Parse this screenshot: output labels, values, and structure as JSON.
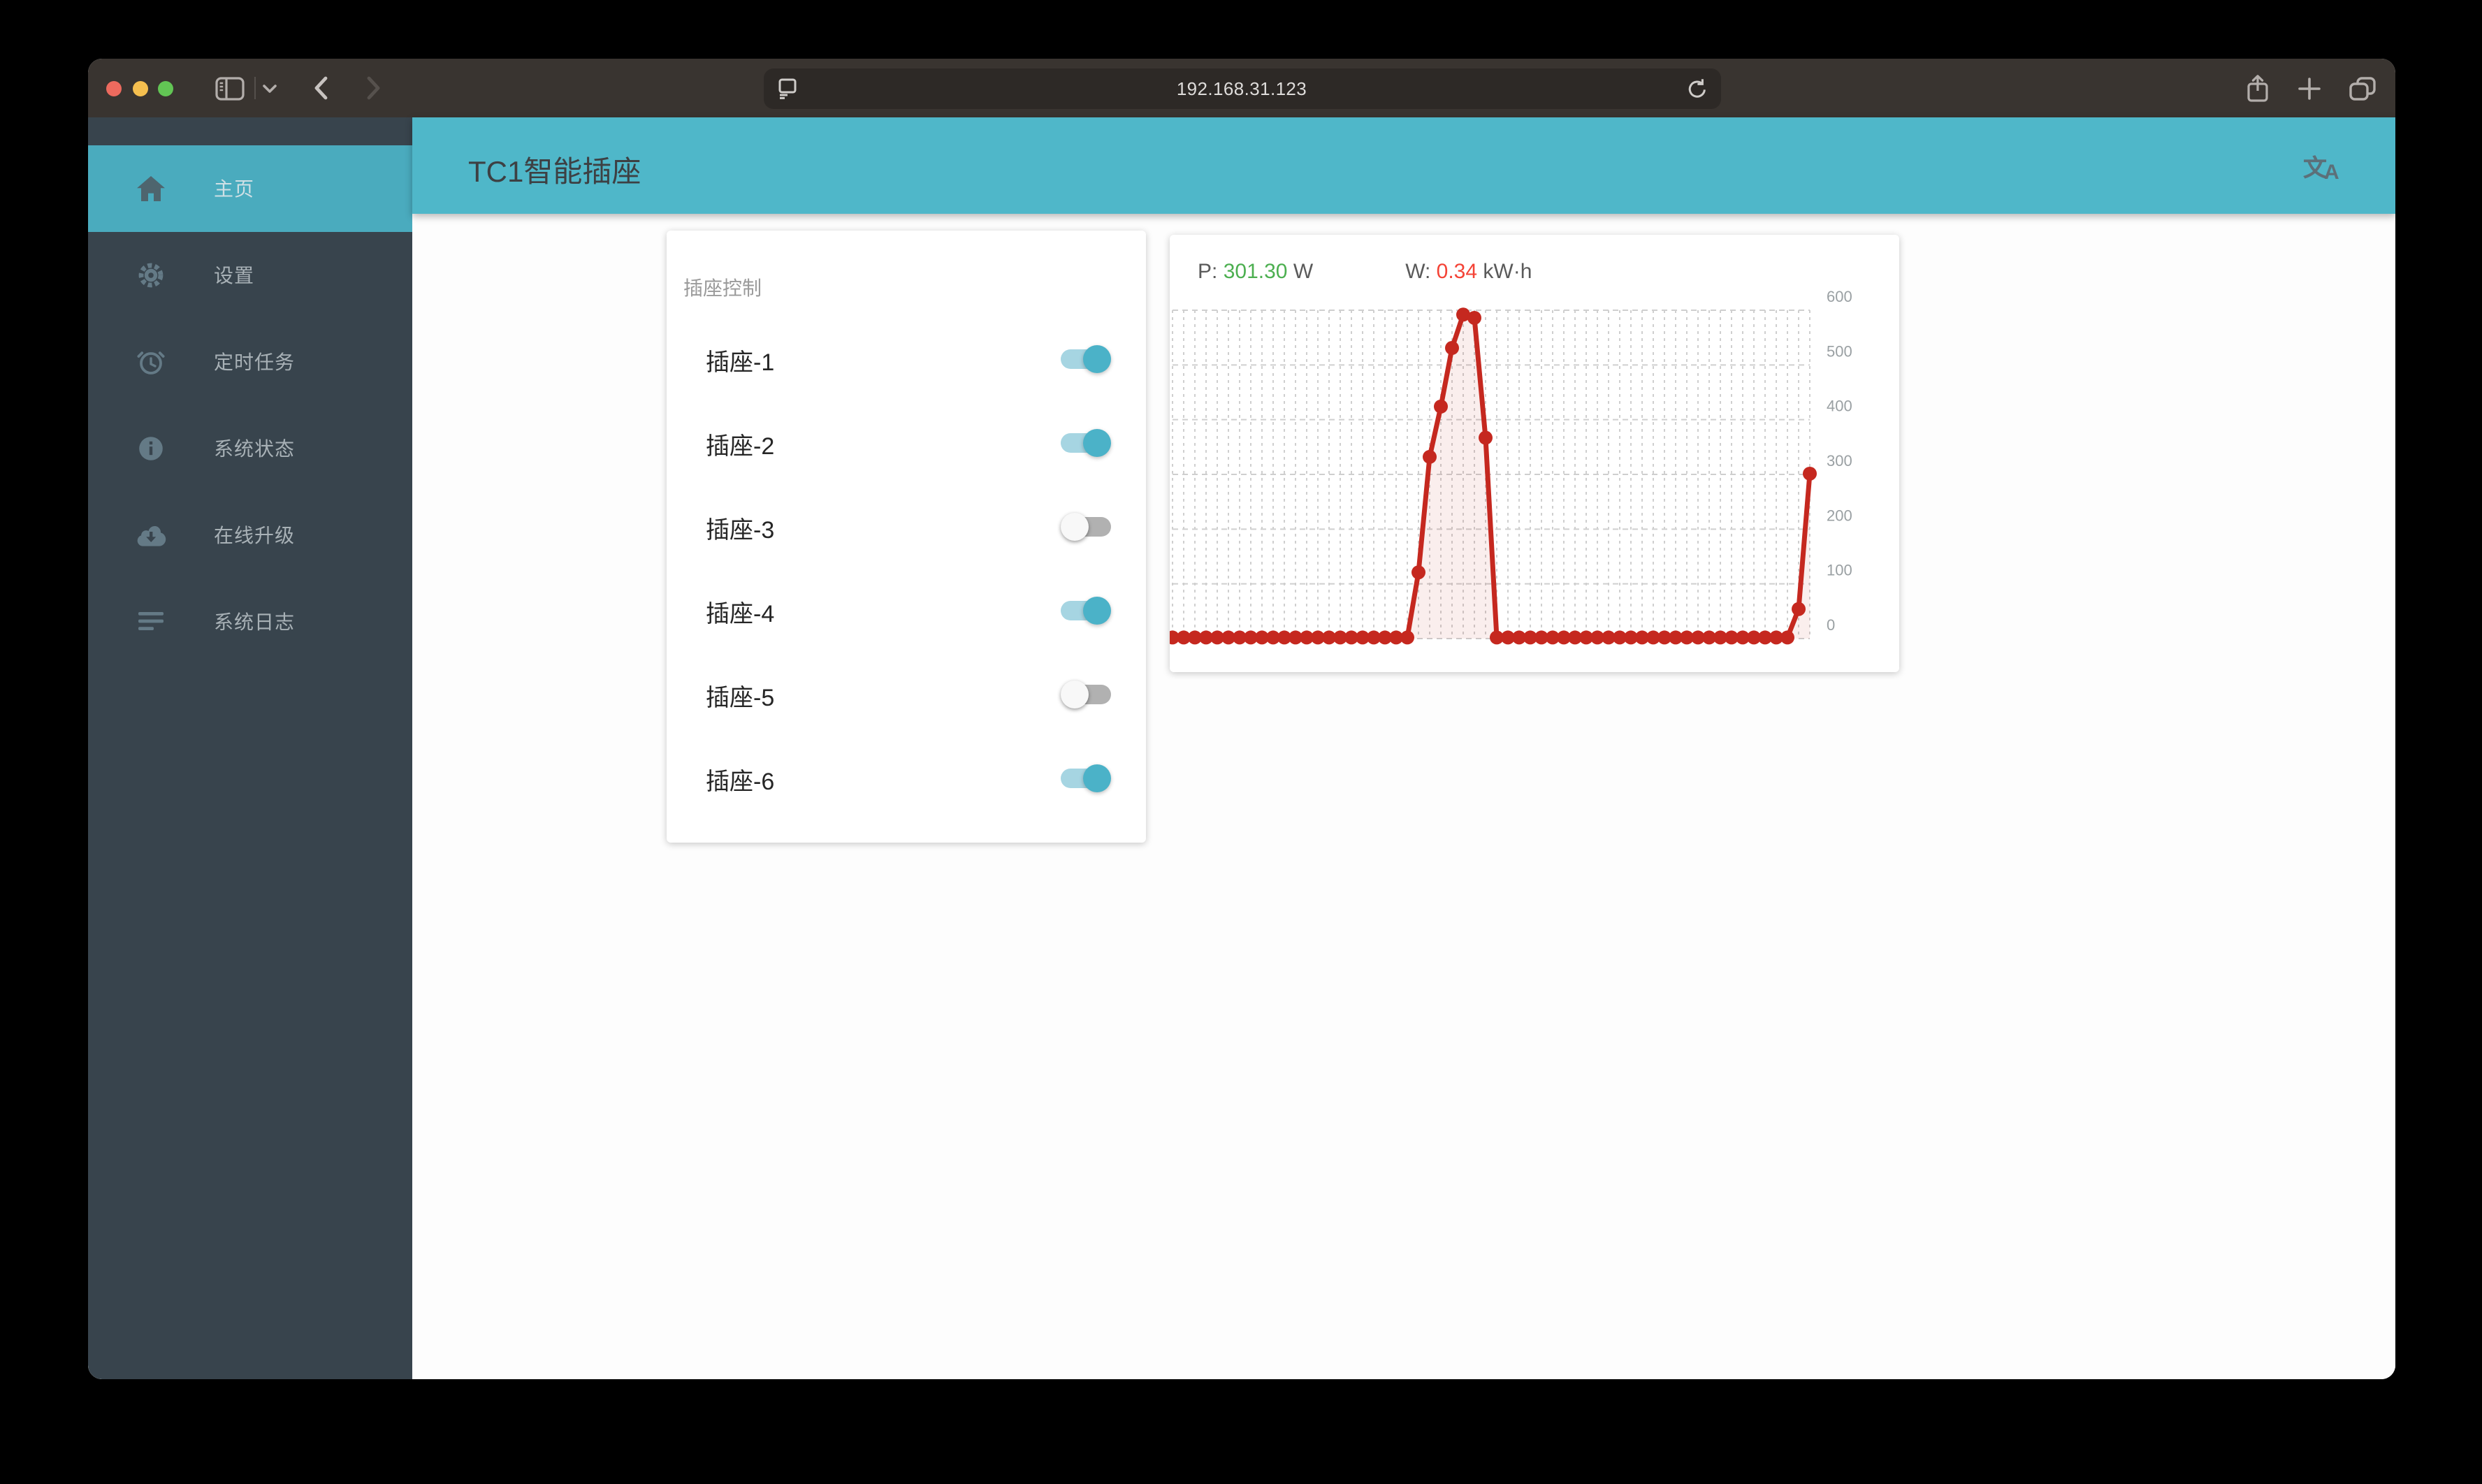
{
  "browser": {
    "url": "192.168.31.123",
    "traffic_lights": [
      "close",
      "minimize",
      "zoom"
    ],
    "toolbar_icons": [
      "sidebar-toggle",
      "chevron-down",
      "back",
      "forward",
      "page-settings",
      "reload",
      "share",
      "new-tab",
      "tab-overview"
    ],
    "toolbar_color": "#393430",
    "urlbar_color": "#2d2926"
  },
  "app": {
    "header": {
      "title": "TC1智能插座",
      "accent_color": "#4fb7c9",
      "translate_icon": "translate-icon",
      "translate_glyph_zh": "文",
      "translate_glyph_en": "A"
    },
    "sidebar": {
      "bg_color": "#38444d",
      "active_color": "#4aabbe",
      "items": [
        {
          "label": "主页",
          "icon": "home-icon",
          "active": true
        },
        {
          "label": "设置",
          "icon": "gear-icon",
          "active": false
        },
        {
          "label": "定时任务",
          "icon": "alarm-clock-icon",
          "active": false
        },
        {
          "label": "系统状态",
          "icon": "info-icon",
          "active": false
        },
        {
          "label": "在线升级",
          "icon": "cloud-download-icon",
          "active": false
        },
        {
          "label": "系统日志",
          "icon": "log-lines-icon",
          "active": false
        }
      ]
    },
    "plug_card": {
      "title": "插座控制",
      "switches": [
        {
          "label": "插座-1",
          "on": true
        },
        {
          "label": "插座-2",
          "on": true
        },
        {
          "label": "插座-3",
          "on": false
        },
        {
          "label": "插座-4",
          "on": true
        },
        {
          "label": "插座-5",
          "on": false
        },
        {
          "label": "插座-6",
          "on": true
        }
      ],
      "toggle_on_color": "#4bb2c8",
      "toggle_on_track": "#a6d5e2",
      "toggle_off_track": "#b1b1b1"
    },
    "chart_card": {
      "p_label": "P:",
      "p_value": "301.30",
      "p_unit": "W",
      "w_label": "W:",
      "w_value": "0.34",
      "w_unit": "kW·h"
    }
  },
  "chart_data": {
    "type": "line",
    "title": "",
    "xlabel": "",
    "ylabel": "",
    "ylim": [
      0,
      600
    ],
    "yticks": [
      0,
      100,
      200,
      300,
      400,
      500,
      600
    ],
    "ytick_side": "right",
    "grid": "dashed",
    "grid_color": "#cfcfcf",
    "tick_color": "#9aa0a3",
    "line_color": "#c5281f",
    "fill_color": "rgba(197,40,31,0.08)",
    "point_radius": 5,
    "current_power_w": 301.3,
    "energy_kwh": 0.34,
    "values": [
      2,
      2,
      2,
      2,
      2,
      2,
      2,
      2,
      2,
      2,
      2,
      2,
      2,
      2,
      2,
      2,
      2,
      2,
      2,
      2,
      2,
      2,
      121,
      332,
      424,
      531,
      592,
      586,
      367,
      2,
      2,
      2,
      2,
      2,
      2,
      2,
      2,
      2,
      2,
      2,
      2,
      2,
      2,
      2,
      2,
      2,
      2,
      2,
      2,
      2,
      2,
      2,
      2,
      2,
      2,
      2,
      54,
      301.3
    ]
  }
}
